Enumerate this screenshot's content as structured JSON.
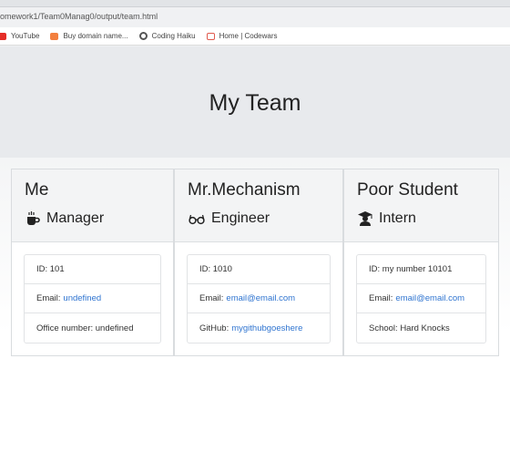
{
  "browser": {
    "url": "omework1/Team0Manag0/output/team.html",
    "bookmarks": [
      {
        "label": "YouTube",
        "icon": "youtube-icon"
      },
      {
        "label": "Buy domain name...",
        "icon": "domain-icon"
      },
      {
        "label": "Coding Haiku",
        "icon": "github-icon"
      },
      {
        "label": "Home | Codewars",
        "icon": "codewars-icon"
      }
    ]
  },
  "page": {
    "title": "My Team"
  },
  "team": [
    {
      "name": "Me",
      "role": "Manager",
      "role_icon": "coffee-mug-icon",
      "fields": [
        {
          "label": "ID: 101",
          "value": ""
        },
        {
          "label": "Email:",
          "value": "undefined"
        },
        {
          "label": "Office number: undefined",
          "value": ""
        }
      ]
    },
    {
      "name": "Mr.Mechanism",
      "role": "Engineer",
      "role_icon": "glasses-icon",
      "fields": [
        {
          "label": "ID: 1010",
          "value": ""
        },
        {
          "label": "Email:",
          "value": "email@email.com"
        },
        {
          "label": "GitHub:",
          "value": "mygithubgoeshere"
        }
      ]
    },
    {
      "name": "Poor Student",
      "role": "Intern",
      "role_icon": "graduate-icon",
      "fields": [
        {
          "label": "ID: my number 10101",
          "value": ""
        },
        {
          "label": "Email:",
          "value": "email@email.com"
        },
        {
          "label": "School: Hard Knocks",
          "value": ""
        }
      ]
    }
  ],
  "colors": {
    "link": "#2f74d0",
    "header_bg": "#e8eaed",
    "card_header_bg": "#f3f4f5"
  }
}
